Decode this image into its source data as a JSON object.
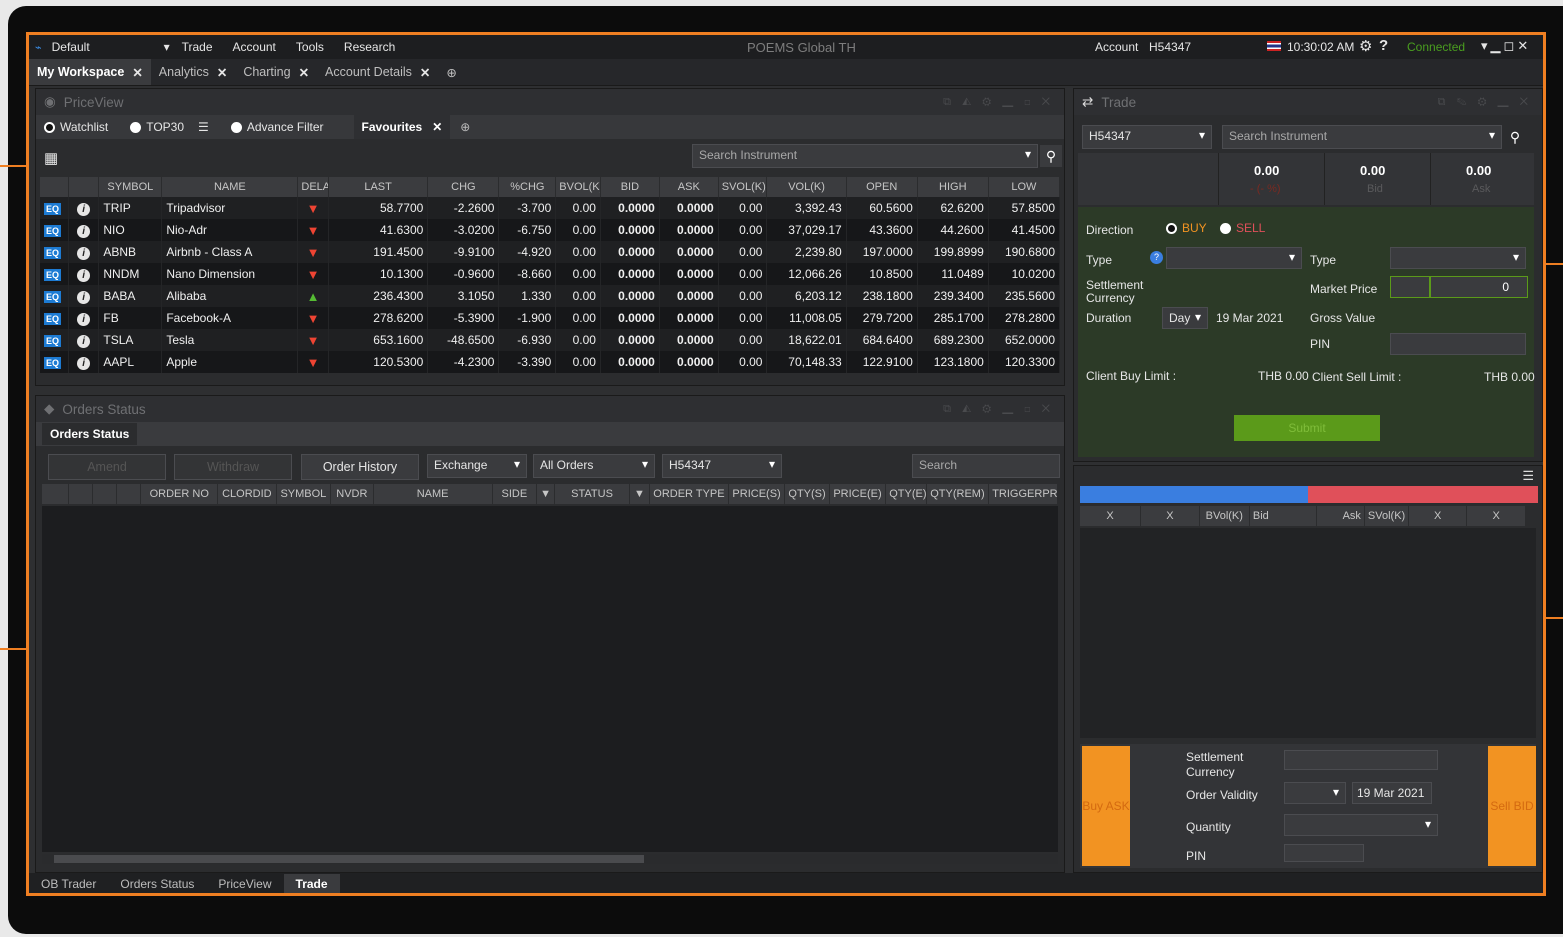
{
  "menu": {
    "profile": "Default",
    "items": [
      "Trade",
      "Account",
      "Tools",
      "Research"
    ],
    "title": "POEMS Global TH",
    "account_label": "Account",
    "account_value": "H54347",
    "time": "10:30:02 AM",
    "status": "Connected"
  },
  "workspace_tabs": [
    "My Workspace",
    "Analytics",
    "Charting",
    "Account Details"
  ],
  "priceview": {
    "title": "PriceView",
    "radios": [
      "Watchlist",
      "TOP30",
      "Advance Filter"
    ],
    "fav_tab": "Favourites",
    "search_placeholder": "Search Instrument",
    "columns": [
      "SYMBOL",
      "NAME",
      "DELAY",
      "LAST",
      "CHG",
      "%CHG",
      "BVOL(K)",
      "BID",
      "ASK",
      "SVOL(K)",
      "VOL(K)",
      "OPEN",
      "HIGH",
      "LOW"
    ],
    "rows": [
      {
        "badge": "EQ",
        "symbol": "TRIP",
        "name": "Tripadvisor",
        "dir": "down",
        "last": "58.7700",
        "chg": "-2.2600",
        "pchg": "-3.700",
        "bvol": "0.00",
        "bid": "0.0000",
        "ask": "0.0000",
        "svol": "0.00",
        "vol": "3,392.43",
        "open": "60.5600",
        "high": "62.6200",
        "low": "57.8500"
      },
      {
        "badge": "EQ",
        "symbol": "NIO",
        "name": "Nio-Adr",
        "dir": "down",
        "last": "41.6300",
        "chg": "-3.0200",
        "pchg": "-6.750",
        "bvol": "0.00",
        "bid": "0.0000",
        "ask": "0.0000",
        "svol": "0.00",
        "vol": "37,029.17",
        "open": "43.3600",
        "high": "44.2600",
        "low": "41.4500"
      },
      {
        "badge": "EQ",
        "symbol": "ABNB",
        "name": "Airbnb - Class A",
        "dir": "down",
        "last": "191.4500",
        "chg": "-9.9100",
        "pchg": "-4.920",
        "bvol": "0.00",
        "bid": "0.0000",
        "ask": "0.0000",
        "svol": "0.00",
        "vol": "2,239.80",
        "open": "197.0000",
        "high": "199.8999",
        "low": "190.6800"
      },
      {
        "badge": "EQ",
        "symbol": "NNDM",
        "name": "Nano Dimension",
        "dir": "down",
        "last": "10.1300",
        "chg": "-0.9600",
        "pchg": "-8.660",
        "bvol": "0.00",
        "bid": "0.0000",
        "ask": "0.0000",
        "svol": "0.00",
        "vol": "12,066.26",
        "open": "10.8500",
        "high": "11.0489",
        "low": "10.0200"
      },
      {
        "badge": "EQ",
        "symbol": "BABA",
        "name": "Alibaba",
        "dir": "up",
        "last": "236.4300",
        "chg": "3.1050",
        "pchg": "1.330",
        "bvol": "0.00",
        "bid": "0.0000",
        "ask": "0.0000",
        "svol": "0.00",
        "vol": "6,203.12",
        "open": "238.1800",
        "high": "239.3400",
        "low": "235.5600"
      },
      {
        "badge": "EQ",
        "symbol": "FB",
        "name": "Facebook-A",
        "dir": "down",
        "last": "278.6200",
        "chg": "-5.3900",
        "pchg": "-1.900",
        "bvol": "0.00",
        "bid": "0.0000",
        "ask": "0.0000",
        "svol": "0.00",
        "vol": "11,008.05",
        "open": "279.7200",
        "high": "285.1700",
        "low": "278.2800"
      },
      {
        "badge": "EQ",
        "symbol": "TSLA",
        "name": "Tesla",
        "dir": "down",
        "last": "653.1600",
        "chg": "-48.6500",
        "pchg": "-6.930",
        "bvol": "0.00",
        "bid": "0.0000",
        "ask": "0.0000",
        "svol": "0.00",
        "vol": "18,622.01",
        "open": "684.6400",
        "high": "689.2300",
        "low": "652.0000"
      },
      {
        "badge": "EQ",
        "symbol": "AAPL",
        "name": "Apple",
        "dir": "down",
        "last": "120.5300",
        "chg": "-4.2300",
        "pchg": "-3.390",
        "bvol": "0.00",
        "bid": "0.0000",
        "ask": "0.0000",
        "svol": "0.00",
        "vol": "70,148.33",
        "open": "122.9100",
        "high": "123.1800",
        "low": "120.3300"
      }
    ]
  },
  "orders": {
    "title": "Orders Status",
    "tab": "Orders Status",
    "buttons": {
      "amend": "Amend",
      "withdraw": "Withdraw",
      "history": "Order History"
    },
    "exchange": "Exchange",
    "filter": "All Orders",
    "account": "H54347",
    "search_placeholder": "Search",
    "columns": [
      "ORDER NO",
      "CLORDID",
      "SYMBOL",
      "NVDR",
      "NAME",
      "SIDE",
      "STATUS",
      "ORDER TYPE",
      "PRICE(S)",
      "QTY(S)",
      "PRICE(E)",
      "QTY(E)",
      "QTY(REM)",
      "TRIGGERPR"
    ]
  },
  "trade": {
    "title": "Trade",
    "account": "H54347",
    "search_placeholder": "Search Instrument",
    "quote": {
      "last": "0.00",
      "bid": "0.00",
      "ask": "0.00",
      "bid_label": "Bid",
      "ask_label": "Ask",
      "chg": "- (- %)"
    },
    "direction_label": "Direction",
    "buy": "BUY",
    "sell": "SELL",
    "type_label": "Type",
    "type2_label": "Type",
    "settlement_label": "Settlement Currency",
    "market_price_label": "Market Price",
    "market_price_value": "0",
    "duration_label": "Duration",
    "duration_value": "Day",
    "date": "19 Mar 2021",
    "gross_value_label": "Gross Value",
    "pin_label": "PIN",
    "client_buy_label": "Client Buy Limit :",
    "client_buy_value": "THB 0.00",
    "client_sell_label": "Client Sell Limit :",
    "client_sell_value": "THB 0.00",
    "submit": "Submit"
  },
  "depth": {
    "columns": [
      "X",
      "X",
      "BVol(K)",
      "Bid",
      "Ask",
      "SVol(K)",
      "X",
      "X"
    ],
    "buy_ask": "Buy ASK",
    "sell_bid": "Sell BID",
    "settlement_label": "Settlement Currency",
    "validity_label": "Order Validity",
    "validity_date": "19 Mar 2021",
    "quantity_label": "Quantity",
    "pin_label": "PIN"
  },
  "bottom_tabs": [
    "OB Trader",
    "Orders Status",
    "PriceView",
    "Trade"
  ],
  "colors": {
    "accent": "#ef7f22",
    "negative": "#d8281c",
    "positive": "#3fa62b",
    "buy_bar": "#3a7ee0",
    "sell_bar": "#e0505a",
    "submit": "#5b9a1a",
    "order_btn": "#f29322"
  }
}
